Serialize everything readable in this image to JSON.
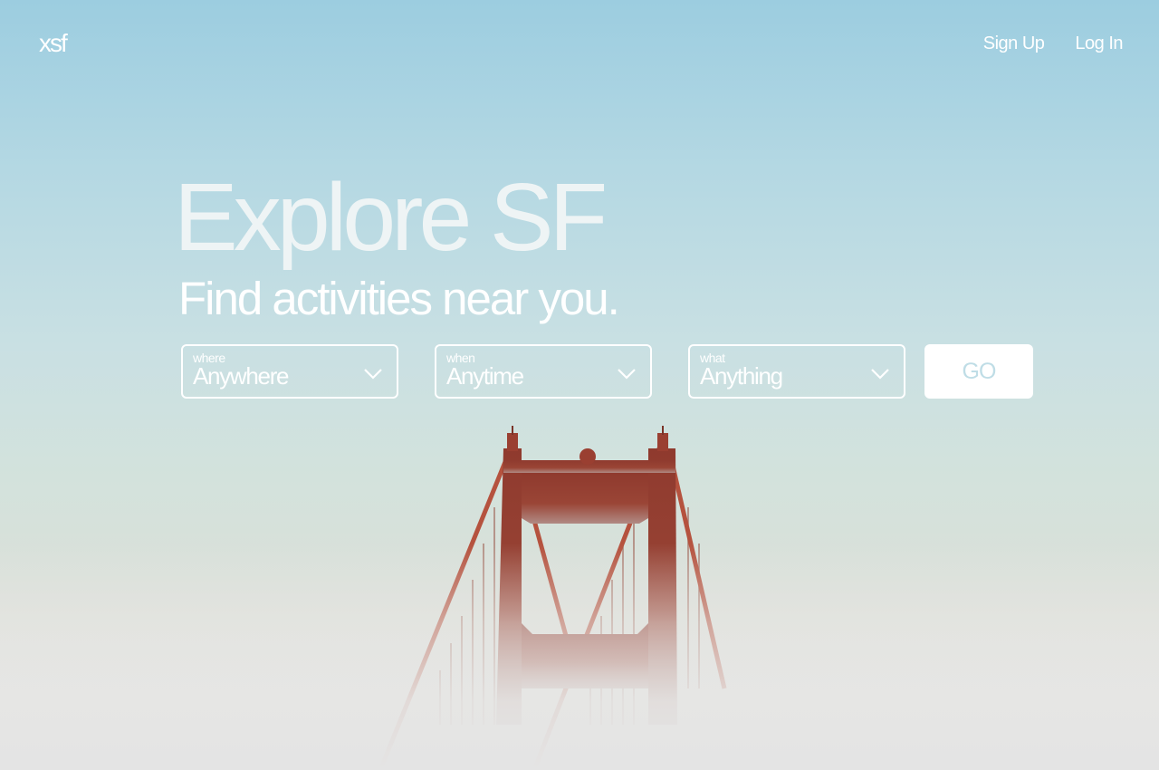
{
  "brand": {
    "logo": "xsf"
  },
  "nav": {
    "signup_label": "Sign Up",
    "login_label": "Log In"
  },
  "hero": {
    "headline": "Explore SF",
    "subheadline": "Find activities near you."
  },
  "search": {
    "where": {
      "label": "where",
      "value": "Anywhere"
    },
    "when": {
      "label": "when",
      "value": "Anytime"
    },
    "what": {
      "label": "what",
      "value": "Anything"
    },
    "go_label": "GO"
  },
  "icons": {
    "dropdown": "chevron-down-icon"
  },
  "colors": {
    "sky_top": "#9ccde0",
    "fog": "#e6e4e2",
    "bridge": "#b04a38",
    "go_text": "#bfdde6"
  }
}
